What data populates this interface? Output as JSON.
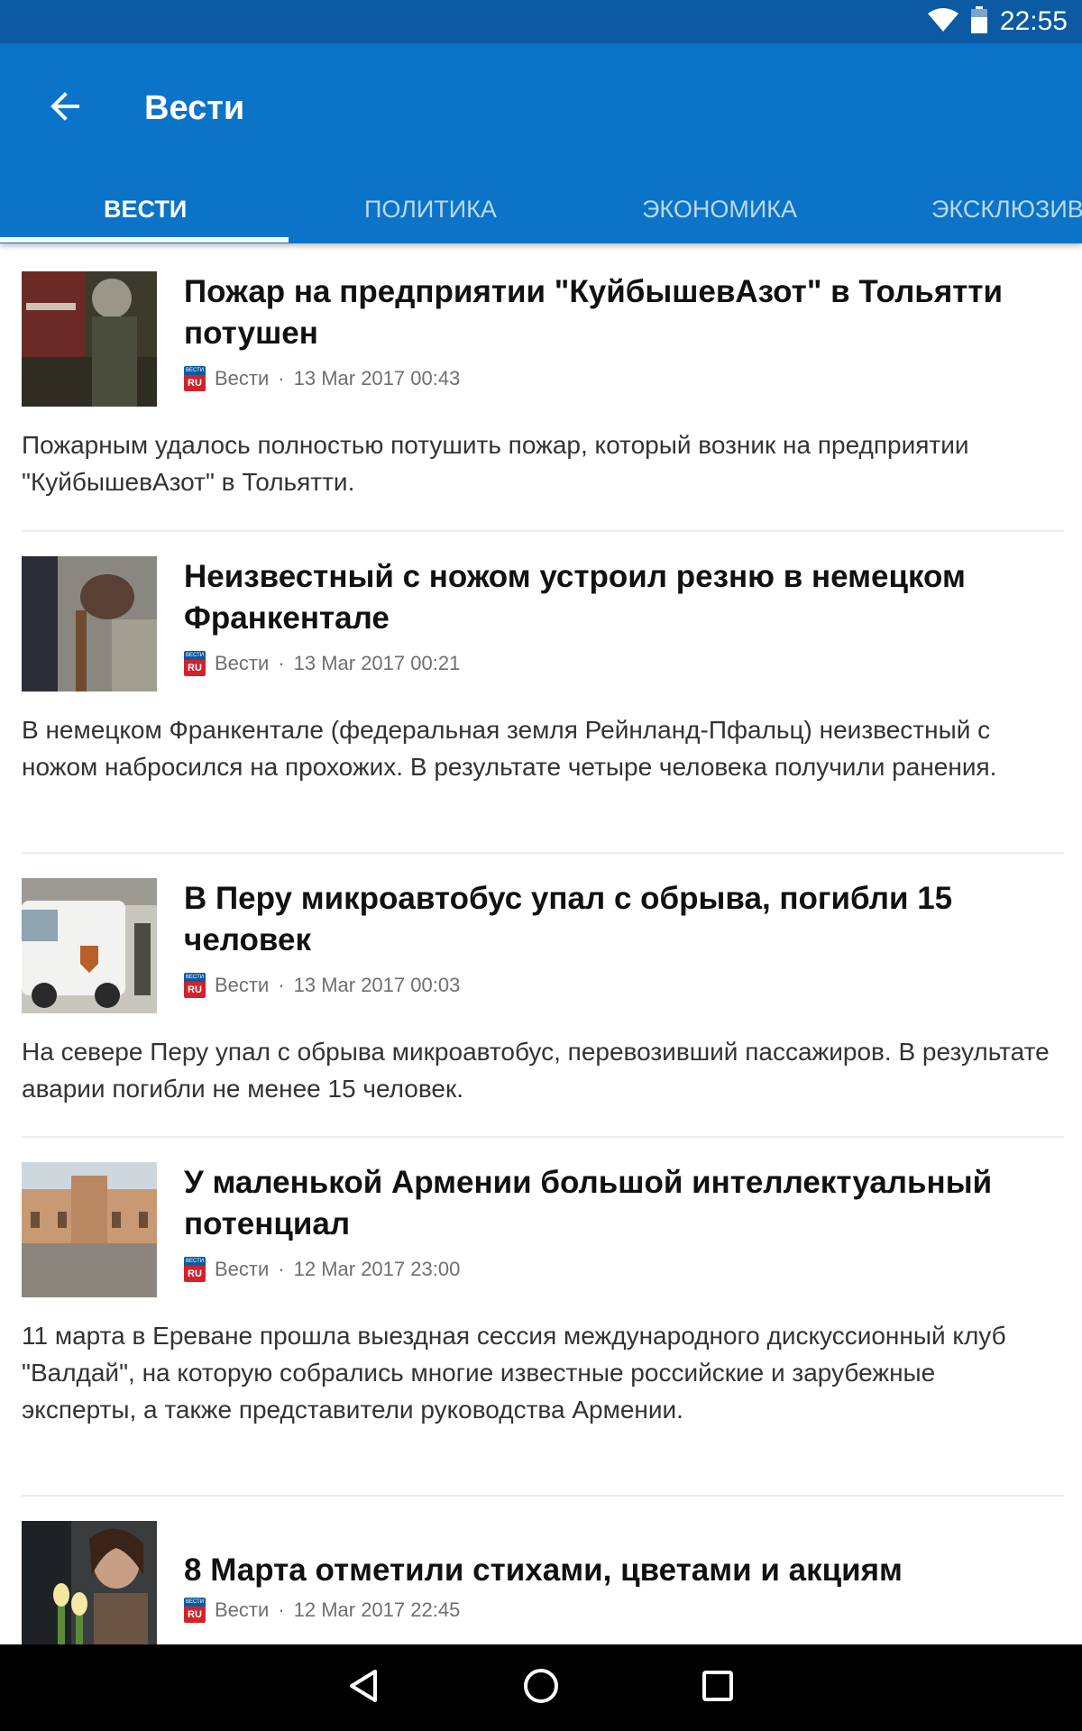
{
  "status_bar": {
    "time": "22:55",
    "icons": [
      "wifi-icon",
      "battery-icon"
    ]
  },
  "app_bar": {
    "title": "Вести",
    "back_icon": "arrow-back-icon",
    "background": "#0b73c8",
    "tabs": [
      {
        "label": "ВЕСТИ",
        "active": true
      },
      {
        "label": "ПОЛИТИКА",
        "active": false
      },
      {
        "label": "ЭКОНОМИКА",
        "active": false
      },
      {
        "label": "ЭКСКЛЮЗИВ",
        "active": false
      }
    ]
  },
  "articles": [
    {
      "title": "Пожар на предприятии \"КуйбышевАзот\" в Тольятти потушен",
      "source": "Вести",
      "date": "13 Mar 2017 00:43",
      "summary": "Пожарным удалось полностью потушить пожар, который возник на предприятии \"КуйбышевАзот\" в Тольятти."
    },
    {
      "title": "Неизвестный с ножом устроил резню в немецком Франкентале",
      "source": "Вести",
      "date": "13 Mar 2017 00:21",
      "summary": "В немецком Франкентале (федеральная земля Рейнланд-Пфальц) неизвестный с ножом набросился на прохожих. В результате четыре человека получили ранения."
    },
    {
      "title": "В Перу микроавтобус упал с обрыва, погибли 15 человек",
      "source": "Вести",
      "date": "13 Mar 2017 00:03",
      "summary": "На севере Перу упал с обрыва микроавтобус, перевозивший пассажиров. В результате аварии погибли не менее 15 человек."
    },
    {
      "title": "У маленькой Армении большой интеллектуальный потенциал",
      "source": "Вести",
      "date": "12 Mar 2017 23:00",
      "summary": "11 марта в Ереване прошла выездная сессия международного дискуссионный клуб \"Валдай\", на которую собрались многие известные российские и зарубежные эксперты, а также представители руководства Армении."
    },
    {
      "title": "8 Марта отметили стихами, цветами и акциям",
      "source": "Вести",
      "date": "12 Mar 2017 22:45",
      "summary": ""
    }
  ],
  "source_logo": {
    "top": "ВЕСТИ",
    "bottom": "RU"
  },
  "nav_bar": {
    "icons": [
      "back-triangle-icon",
      "home-circle-icon",
      "recents-square-icon"
    ]
  }
}
